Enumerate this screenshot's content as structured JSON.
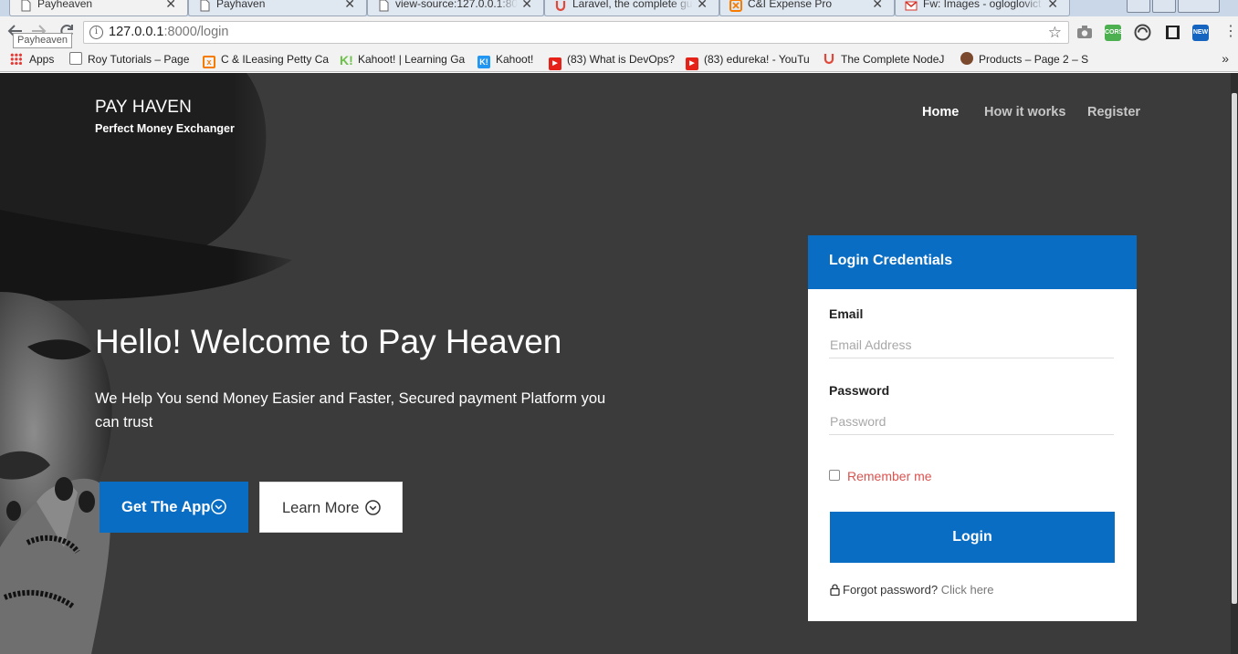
{
  "browser": {
    "tabs": [
      {
        "title": "Payheaven",
        "active": true,
        "favicon": "page-icon"
      },
      {
        "title": "Payhaven",
        "active": false,
        "favicon": "page-icon"
      },
      {
        "title": "view-source:127.0.0.1:800",
        "active": false,
        "favicon": "page-icon"
      },
      {
        "title": "Laravel, the complete gu",
        "active": false,
        "favicon": "udemy-icon"
      },
      {
        "title": "C&I Expense Pro",
        "active": false,
        "favicon": "xampp-icon"
      },
      {
        "title": "Fw: Images - ogloglovict",
        "active": false,
        "favicon": "gmail-icon"
      }
    ],
    "tab_close_glyph": "✕",
    "url_host": "127.0.0.1",
    "url_path": ":8000/login",
    "tooltip": "Payheaven",
    "extensions": [
      {
        "label": "CORS",
        "color": "#4caf50"
      },
      {
        "label": "NEW",
        "color": "#1565c0"
      }
    ],
    "bookmarks": [
      {
        "label": "Apps",
        "icon": "apps-grid-icon"
      },
      {
        "label": "Roy Tutorials – Page",
        "icon": "page-icon"
      },
      {
        "label": "C & ILeasing Petty Ca",
        "icon": "xampp-icon"
      },
      {
        "label": "Kahoot! | Learning Ga",
        "icon": "kahoot-icon"
      },
      {
        "label": "Kahoot!",
        "icon": "kahoot-blue-icon"
      },
      {
        "label": "(83) What is DevOps?",
        "icon": "youtube-icon"
      },
      {
        "label": "(83) edureka! - YouTu",
        "icon": "youtube-icon"
      },
      {
        "label": "The Complete NodeJ",
        "icon": "udemy-icon"
      },
      {
        "label": "Products – Page 2 – S",
        "icon": "avatar-icon"
      }
    ],
    "bookmarks_overflow": "»"
  },
  "site": {
    "brand": "PAY HAVEN",
    "tagline": "Perfect Money Exchanger",
    "nav": [
      {
        "label": "Home",
        "current": true
      },
      {
        "label": "How it works",
        "current": false
      },
      {
        "label": "Register",
        "current": false
      }
    ]
  },
  "hero": {
    "headline": "Hello! Welcome to Pay Heaven",
    "subtext": "We Help You send Money Easier and Faster, Secured payment Platform you can trust",
    "primary_button": "Get The App",
    "secondary_button": "Learn More"
  },
  "login": {
    "title": "Login Credentials",
    "email_label": "Email",
    "email_placeholder": "Email Address",
    "email_value": "",
    "password_label": "Password",
    "password_placeholder": "Password",
    "password_value": "",
    "remember_label": "Remember me",
    "remember_checked": false,
    "submit_label": "Login",
    "forgot_text": "Forgot password?",
    "forgot_link": "Click here"
  },
  "colors": {
    "accent": "#0a6dc4",
    "hero_bg": "#3b3b3b",
    "remember_text": "#d9534f",
    "card_bg": "#ffffff"
  }
}
